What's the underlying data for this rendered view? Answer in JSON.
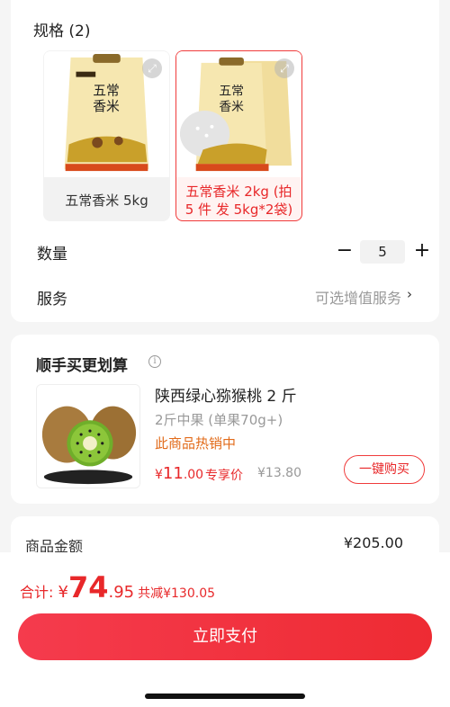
{
  "spec": {
    "title": "规格 (2)",
    "options": [
      {
        "label": "五常香米 5kg",
        "selected": false
      },
      {
        "label": "五常香米 2kg (拍 5 件 发 5kg*2袋)",
        "selected": true
      }
    ]
  },
  "quantity": {
    "label": "数量",
    "value": "5",
    "minus": "−",
    "plus": "+"
  },
  "service": {
    "label": "服务",
    "value": "可选增值服务",
    "chevron": "›"
  },
  "addon": {
    "title": "顺手买更划算",
    "info": "i",
    "name": "陕西绿心猕猴桃 2 斤",
    "spec": "2斤中果 (单果70g+)",
    "hot": "此商品热销中",
    "price_currency": "¥",
    "price_int": "11",
    "price_dec": ".00",
    "price_tag": "专享价",
    "orig_price": "¥13.80",
    "buy_label": "一键购买"
  },
  "summary": {
    "label": "商品金额",
    "value": "¥205.00"
  },
  "footer": {
    "total_label": "合计: ",
    "currency": "¥",
    "total_int": "74",
    "total_dec": ".95",
    "saved": "共减¥130.05",
    "pay_label": "立即支付"
  },
  "colors": {
    "accent": "#e8282a",
    "hot": "#e26b1a",
    "muted": "#999999"
  }
}
